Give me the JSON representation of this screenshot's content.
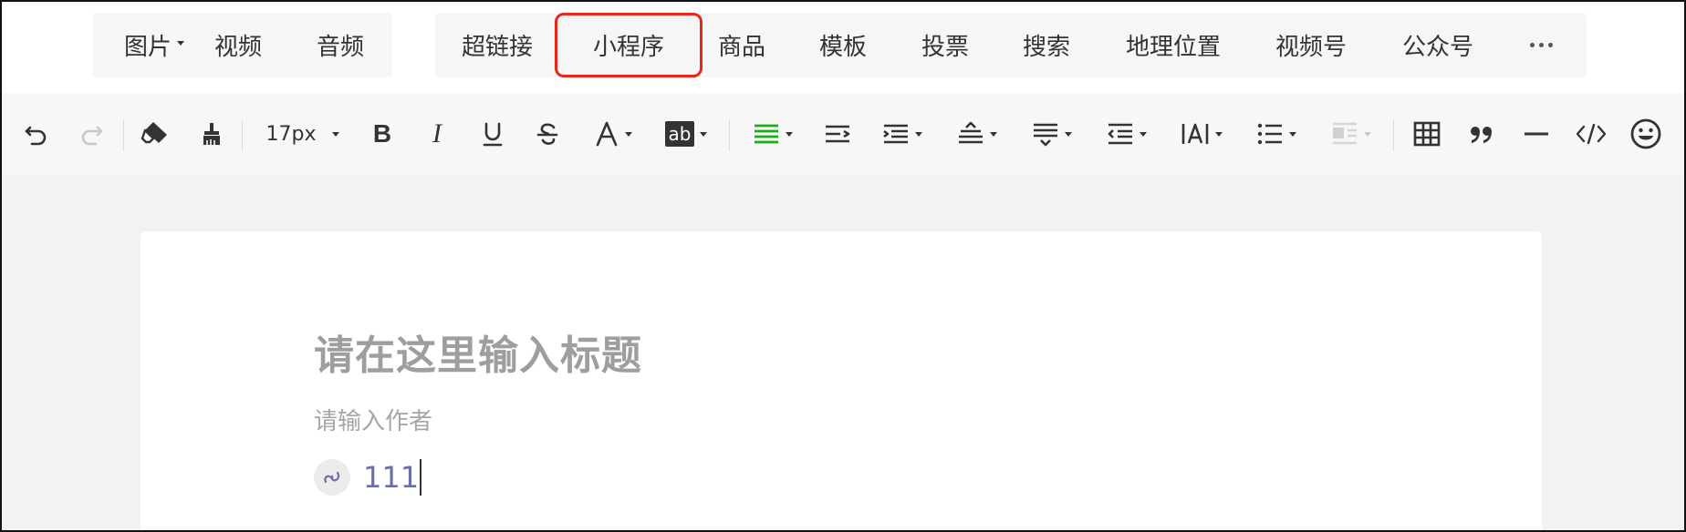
{
  "insert_bar": {
    "image": "图片",
    "video": "视频",
    "audio": "音频",
    "hyperlink": "超链接",
    "mini_program": "小程序",
    "product": "商品",
    "template": "模板",
    "vote": "投票",
    "search": "搜索",
    "location": "地理位置",
    "channels": "视频号",
    "official_account": "公众号",
    "more_icon": "more-horizontal-icon"
  },
  "format_bar": {
    "font_size": "17px",
    "bold": "B",
    "italic": "I",
    "icons": [
      "undo-icon",
      "redo-icon",
      "eraser-icon",
      "format-painter-icon",
      "bold-icon",
      "italic-icon",
      "underline-icon",
      "strikethrough-icon",
      "font-color-icon",
      "highlight-color-icon",
      "align-justify-icon",
      "indent-first-line-icon",
      "align-icon",
      "line-height-icon",
      "paragraph-spacing-icon",
      "indent-icon",
      "letter-spacing-icon",
      "unordered-list-icon",
      "float-icon",
      "table-icon",
      "quote-icon",
      "divider-icon",
      "code-icon",
      "emoji-icon"
    ],
    "highlight_label": "ab",
    "accent_green": "#1aad19"
  },
  "editor": {
    "title_placeholder": "请在这里输入标题",
    "author_placeholder": "请输入作者",
    "mini_program_text": "111"
  },
  "colors": {
    "highlight_border": "#e8261a",
    "mini_icon": "#6a6fa8"
  }
}
